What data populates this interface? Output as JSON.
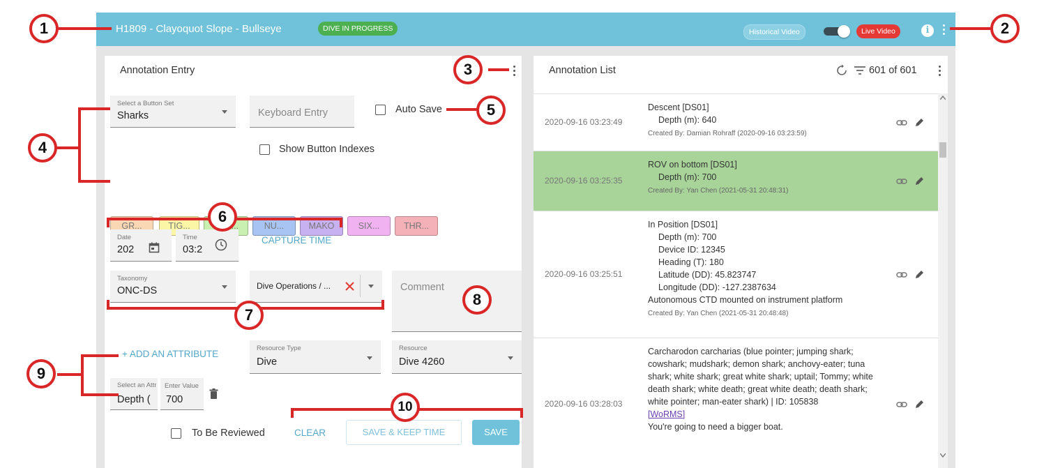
{
  "header": {
    "title": "H1809 - Clayoquot Slope - Bullseye",
    "status_badge": "DIVE IN PROGRESS",
    "historical_label": "Historical Video",
    "live_label": "Live Video",
    "info_glyph": "i"
  },
  "entry": {
    "title": "Annotation Entry",
    "button_set": {
      "label": "Select a Button Set",
      "value": "Sharks"
    },
    "keyboard_placeholder": "Keyboard Entry",
    "auto_save_label": "Auto Save",
    "show_indexes_label": "Show Button Indexes",
    "chips": [
      {
        "label": "GR...",
        "color": "#fad7b4"
      },
      {
        "label": "TIG...",
        "color": "#fbf5a6"
      },
      {
        "label": "LEM...",
        "color": "#c9efb1"
      },
      {
        "label": "NU...",
        "color": "#a7c4f3"
      },
      {
        "label": "MAKO",
        "color": "#c7b1f0"
      },
      {
        "label": "SIX...",
        "color": "#f1b2f2"
      },
      {
        "label": "THR...",
        "color": "#f4b2b8"
      }
    ],
    "date": {
      "label": "Date",
      "value": "202"
    },
    "time": {
      "label": "Time",
      "value": "03:2"
    },
    "capture_time_label": "CAPTURE TIME",
    "taxonomy": {
      "label": "Taxonomy",
      "value": "ONC-DS"
    },
    "dive_ops_value": "Dive Operations / ...",
    "comment_placeholder": "Comment",
    "add_attribute_label": "+ ADD AN ATTRIBUTE",
    "resource_type": {
      "label": "Resource Type",
      "value": "Dive"
    },
    "resource": {
      "label": "Resource",
      "value": "Dive 4260"
    },
    "attribute_select": {
      "label": "Select an Attribute",
      "value": "Depth ("
    },
    "attribute_value": {
      "label": "Enter Value",
      "value": "700"
    },
    "to_be_reviewed_label": "To Be Reviewed",
    "clear_label": "CLEAR",
    "save_keep_label": "SAVE & KEEP TIME",
    "save_label": "SAVE"
  },
  "list": {
    "title": "Annotation List",
    "count": "601 of 601",
    "rows": [
      {
        "time": "2020-09-16 03:23:49",
        "title": "Descent [DS01]",
        "details": [
          "Depth (m): 640"
        ],
        "extra": [],
        "created": "Created By: Damian Rohraff (2020-09-16 03:23:59)",
        "selected": false
      },
      {
        "time": "2020-09-16 03:25:35",
        "title": "ROV on bottom [DS01]",
        "details": [
          "Depth (m): 700"
        ],
        "extra": [],
        "created": "Created By: Yan Chen (2021-05-31 20:48:31)",
        "selected": true
      },
      {
        "time": "2020-09-16 03:25:51",
        "title": "In Position [DS01]",
        "details": [
          "Depth (m): 700",
          "Device ID: 12345",
          "Heading (T): 180",
          "Latitude (DD): 45.823747",
          "Longitude (DD): -127.2387634"
        ],
        "extra": [
          "Autonomous CTD mounted on instrument platform"
        ],
        "created": "Created By: Yan Chen (2021-05-31 20:48:48)",
        "selected": false
      },
      {
        "time": "2020-09-16 03:28:03",
        "title": "Carcharodon carcharias (blue pointer; jumping shark; cowshark; mudshark; demon shark; anchovy-eater; tuna shark; white shark; great white shark; uptail; Tommy; white death shark; white death; great white death; death shark; white pointer; man-eater shark) | ID: 105838",
        "link": "[WoRMS]",
        "extra": [
          "You're going to need a bigger boat."
        ],
        "selected": false
      }
    ]
  },
  "callouts": [
    "1",
    "2",
    "3",
    "4",
    "5",
    "6",
    "7",
    "8",
    "9",
    "10"
  ],
  "colors": {
    "accent": "#6fc2d9",
    "callout": "#d92626",
    "selected_row": "#a8d49a",
    "live": "#e53935",
    "progress": "#4caf50"
  }
}
